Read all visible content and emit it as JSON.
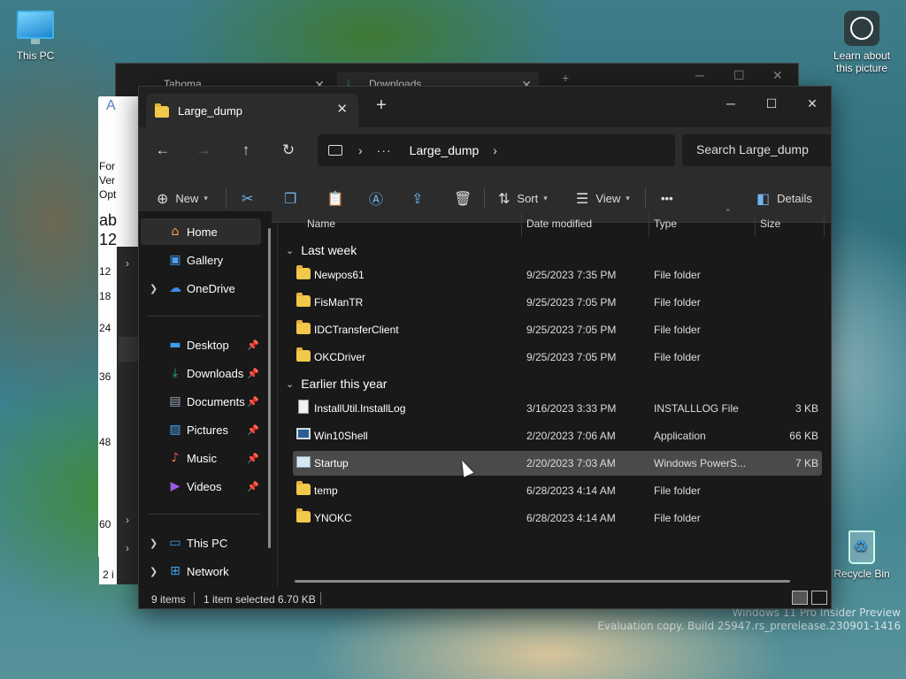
{
  "desktop": {
    "this_pc_label": "This PC",
    "learn_label_1": "Learn about",
    "learn_label_2": "this picture",
    "recycle_label": "Recycle Bin",
    "watermark_1": "Windows 11 Pro Insider Preview",
    "watermark_2": "Evaluation copy. Build 25947.rs_prerelease.230901-1416"
  },
  "bg_window": {
    "tab1": "Tahoma",
    "tab2": "Downloads",
    "doc_fragments": [
      "A",
      "For",
      "Ver",
      "Opt",
      "ab",
      "12"
    ],
    "ruler_numbers": [
      "12",
      "18",
      "24",
      "36",
      "48",
      "60",
      "2 i"
    ]
  },
  "explorer": {
    "tab_title": "Large_dump",
    "breadcrumb": "Large_dump",
    "search_placeholder": "Search Large_dump",
    "commands": {
      "new": "New",
      "sort": "Sort",
      "view": "View",
      "more": "•••",
      "details": "Details"
    },
    "nav": {
      "home": "Home",
      "gallery": "Gallery",
      "onedrive": "OneDrive",
      "desktop": "Desktop",
      "downloads": "Downloads",
      "documents": "Documents",
      "pictures": "Pictures",
      "music": "Music",
      "videos": "Videos",
      "this_pc": "This PC",
      "network": "Network"
    },
    "columns": {
      "name": "Name",
      "date": "Date modified",
      "type": "Type",
      "size": "Size"
    },
    "groups": {
      "g1": "Last week",
      "g2": "Earlier this year"
    },
    "files": [
      {
        "name": "Newpos61",
        "date": "9/25/2023 7:35 PM",
        "type": "File folder",
        "size": ""
      },
      {
        "name": "FisManTR",
        "date": "9/25/2023 7:05 PM",
        "type": "File folder",
        "size": ""
      },
      {
        "name": "IDCTransferClient",
        "date": "9/25/2023 7:05 PM",
        "type": "File folder",
        "size": ""
      },
      {
        "name": "OKCDriver",
        "date": "9/25/2023 7:05 PM",
        "type": "File folder",
        "size": ""
      },
      {
        "name": "InstallUtil.InstallLog",
        "date": "3/16/2023 3:33 PM",
        "type": "INSTALLLOG File",
        "size": "3 KB"
      },
      {
        "name": "Win10Shell",
        "date": "2/20/2023 7:06 AM",
        "type": "Application",
        "size": "66 KB"
      },
      {
        "name": "Startup",
        "date": "2/20/2023 7:03 AM",
        "type": "Windows PowerS...",
        "size": "7 KB"
      },
      {
        "name": "temp",
        "date": "6/28/2023 4:14 AM",
        "type": "File folder",
        "size": ""
      },
      {
        "name": "YNOKC",
        "date": "6/28/2023 4:14 AM",
        "type": "File folder",
        "size": ""
      }
    ],
    "status": {
      "count": "9 items",
      "selection": "1 item selected  6.70 KB"
    }
  }
}
